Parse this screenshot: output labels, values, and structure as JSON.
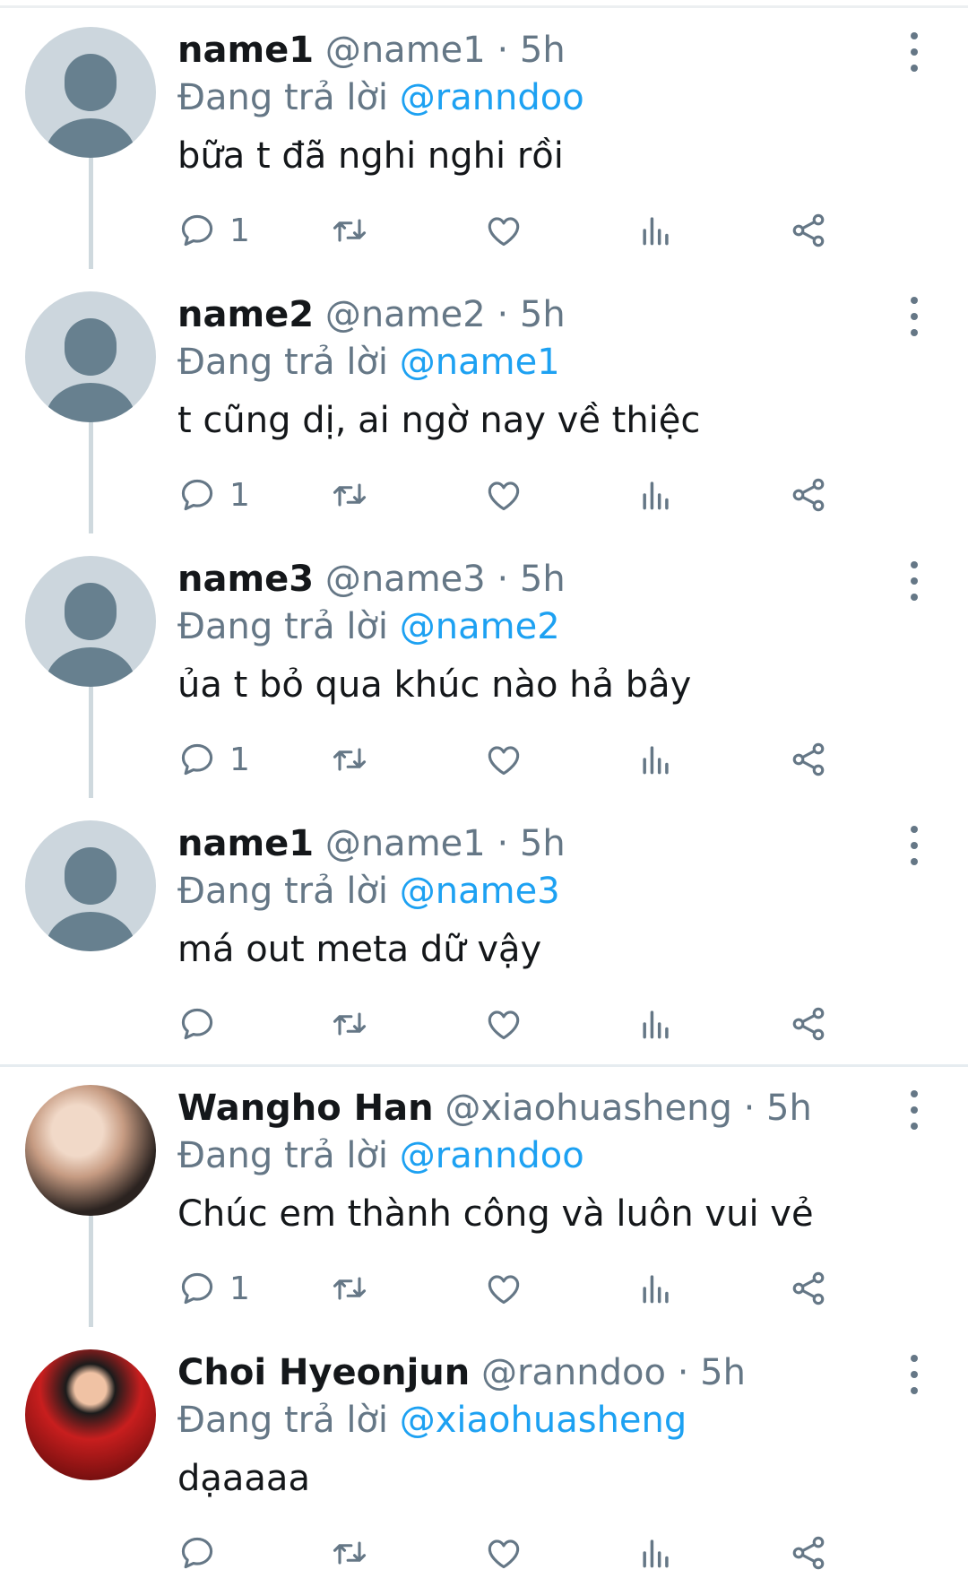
{
  "reply_prefix": "Đang trả lời",
  "colors": {
    "accent": "#1da1f2",
    "muted": "#657786",
    "text": "#14171a",
    "thread_line": "#cfd9de",
    "avatar_placeholder": "#ccd6dd"
  },
  "icons": [
    "more-vertical-icon",
    "reply-icon",
    "retweet-icon",
    "like-icon",
    "analytics-icon",
    "share-icon"
  ],
  "tweets": [
    {
      "name": "name1",
      "handle": "@name1",
      "separator": "·",
      "time": "5h",
      "mention": "@ranndoo",
      "text": "bữa t đã nghi nghi rồi",
      "reply_count": "1"
    },
    {
      "name": "name2",
      "handle": "@name2",
      "separator": "·",
      "time": "5h",
      "mention": "@name1",
      "text": "t cũng dị, ai ngờ nay về thiệc",
      "reply_count": "1"
    },
    {
      "name": "name3",
      "handle": "@name3",
      "separator": "·",
      "time": "5h",
      "mention": "@name2",
      "text": "ủa t bỏ qua khúc nào hả bây",
      "reply_count": "1"
    },
    {
      "name": "name1",
      "handle": "@name1",
      "separator": "·",
      "time": "5h",
      "mention": "@name3",
      "text": "má out meta dữ vậy",
      "reply_count": ""
    },
    {
      "name": "Wangho Han",
      "handle": "@xiaohuasheng",
      "separator": "·",
      "time": "5h",
      "mention": "@ranndoo",
      "text": "Chúc em thành công và luôn vui vẻ",
      "reply_count": "1"
    },
    {
      "name": "Choi Hyeonjun",
      "handle": "@ranndoo",
      "separator": "·",
      "time": "5h",
      "mention": "@xiaohuasheng",
      "text": "dạaaaa",
      "reply_count": ""
    }
  ]
}
